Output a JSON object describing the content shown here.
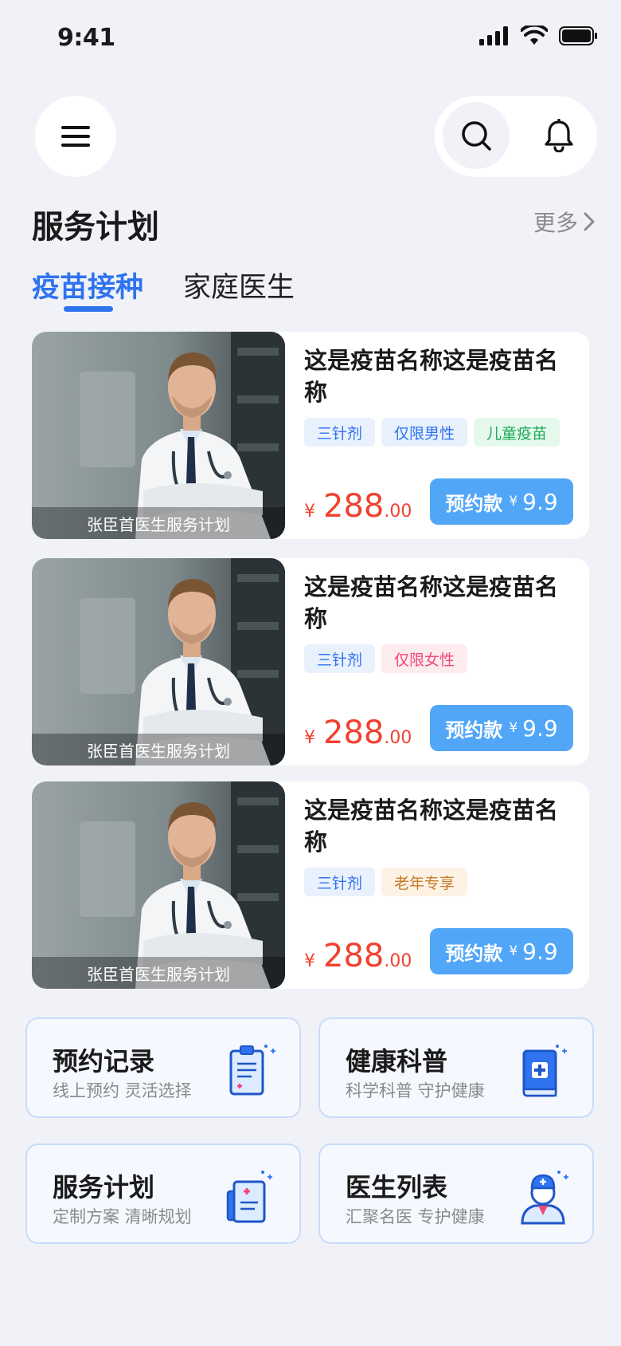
{
  "status_bar": {
    "time": "9:41"
  },
  "section": {
    "title": "服务计划",
    "more": "更多"
  },
  "tabs": [
    {
      "label": "疫苗接种",
      "active": true
    },
    {
      "label": "家庭医生",
      "active": false
    }
  ],
  "cards": [
    {
      "caption": "张臣首医生服务计划",
      "title": "这是疫苗名称这是疫苗名称",
      "tags": [
        {
          "label": "三针剂",
          "color": "blue"
        },
        {
          "label": "仅限男性",
          "color": "blue"
        },
        {
          "label": "儿童疫苗",
          "color": "green"
        }
      ],
      "price": {
        "currency": "¥",
        "integer": "288",
        "decimal": ".00"
      },
      "book": {
        "label": "预约款",
        "currency": "¥",
        "amount": "9.9"
      }
    },
    {
      "caption": "张臣首医生服务计划",
      "title": "这是疫苗名称这是疫苗名称",
      "tags": [
        {
          "label": "三针剂",
          "color": "blue"
        },
        {
          "label": "仅限女性",
          "color": "pink"
        }
      ],
      "price": {
        "currency": "¥",
        "integer": "288",
        "decimal": ".00"
      },
      "book": {
        "label": "预约款",
        "currency": "¥",
        "amount": "9.9"
      }
    },
    {
      "caption": "张臣首医生服务计划",
      "title": "这是疫苗名称这是疫苗名称",
      "tags": [
        {
          "label": "三针剂",
          "color": "blue"
        },
        {
          "label": "老年专享",
          "color": "orange"
        }
      ],
      "price": {
        "currency": "¥",
        "integer": "288",
        "decimal": ".00"
      },
      "book": {
        "label": "预约款",
        "currency": "¥",
        "amount": "9.9"
      }
    }
  ],
  "features": [
    {
      "title": "预约记录",
      "subtitle": "线上预约 灵活选择",
      "icon": "clipboard-icon"
    },
    {
      "title": "健康科普",
      "subtitle": "科学科普 守护健康",
      "icon": "medical-book-icon"
    },
    {
      "title": "服务计划",
      "subtitle": "定制方案 清晰规划",
      "icon": "medical-record-icon"
    },
    {
      "title": "医生列表",
      "subtitle": "汇聚名医 专护健康",
      "icon": "doctor-icon"
    }
  ],
  "colors": {
    "accent": "#2F73F0",
    "price": "#F0412F",
    "book_button": "#52A6F8",
    "background": "#F1F2F8"
  }
}
